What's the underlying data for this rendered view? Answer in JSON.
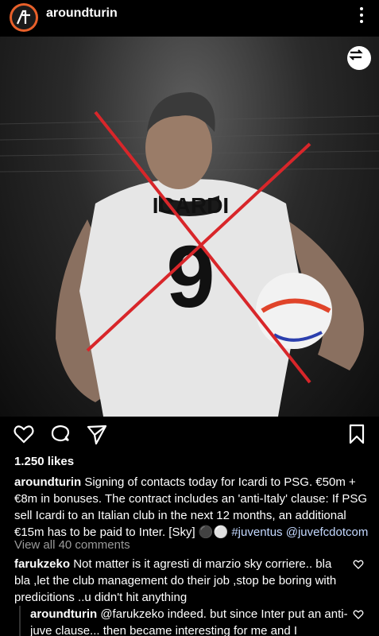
{
  "header": {
    "username": "aroundturin",
    "avatar_initials": "AT"
  },
  "image": {
    "jersey_name": "ICARDI",
    "jersey_number": "9"
  },
  "actions": {
    "like_icon": "heart-icon",
    "comment_icon": "comment-icon",
    "share_icon": "share-icon",
    "save_icon": "bookmark-icon"
  },
  "likes": "1.250 likes",
  "caption": {
    "username": "aroundturin",
    "text": "Signing of contacts today for Icardi to PSG. €50m + €8m in bonuses. The contract includes an 'anti-Italy' clause: If PSG sell Icardi to an Italian club in the next 12 months, an additional €15m has to be paid to Inter. [Sky] ⚫⚪",
    "hashtag": "#juventus",
    "mention": "@juvefcdotcom"
  },
  "view_all_comments": "View all 40 comments",
  "comments": [
    {
      "username": "farukzeko",
      "text": "Not matter is it agresti di marzio sky corriere.. bla bla ,let the club management do their job ,stop be boring with predicitions ..u didn't hit anything"
    },
    {
      "username": "aroundturin",
      "text": "@farukzeko indeed. but since Inter put an anti-juve clause... then became interesting for me and I"
    }
  ],
  "colors": {
    "background": "#000000",
    "cross": "#d8262a",
    "hashtag": "#c3d8ff",
    "muted": "#9a9a9a"
  }
}
